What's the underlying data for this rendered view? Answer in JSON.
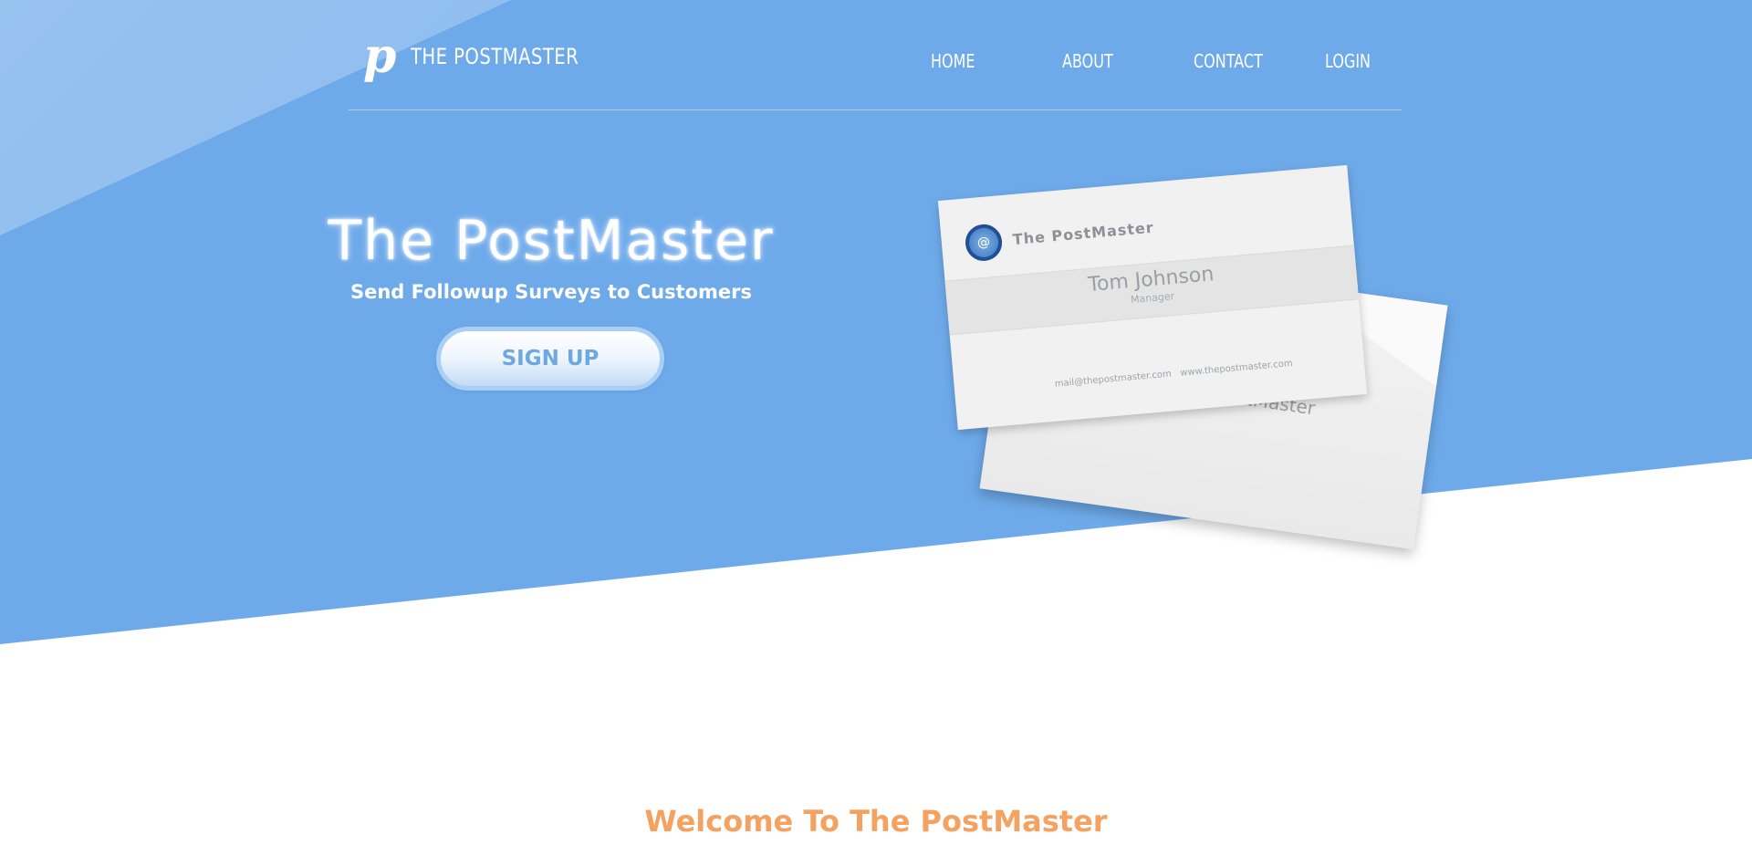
{
  "brand": {
    "logo_glyph": "p",
    "name": "THE POSTMASTER"
  },
  "nav": {
    "home": "HOME",
    "about": "ABOUT",
    "contact": "CONTACT",
    "login": "LOGIN"
  },
  "hero": {
    "title": "The PostMaster",
    "subtitle": "Send Followup Surveys to Customers",
    "signup_label": "SIGN UP"
  },
  "illustration": {
    "card": {
      "company": "The PostMaster",
      "person_name": "Tom Johnson",
      "person_role": "Manager",
      "email": "mail@thepostmaster.com",
      "website": "www.thepostmaster.com",
      "seal_symbol": "@"
    },
    "envelope": {
      "company": "The PostMaster"
    }
  },
  "welcome": {
    "heading": "Welcome To The PostMaster"
  },
  "colors": {
    "hero_blue": "#6eaaea",
    "accent_orange": "#f5a15f",
    "seal_navy": "#1f4f95",
    "button_text": "#6ea8e2"
  }
}
